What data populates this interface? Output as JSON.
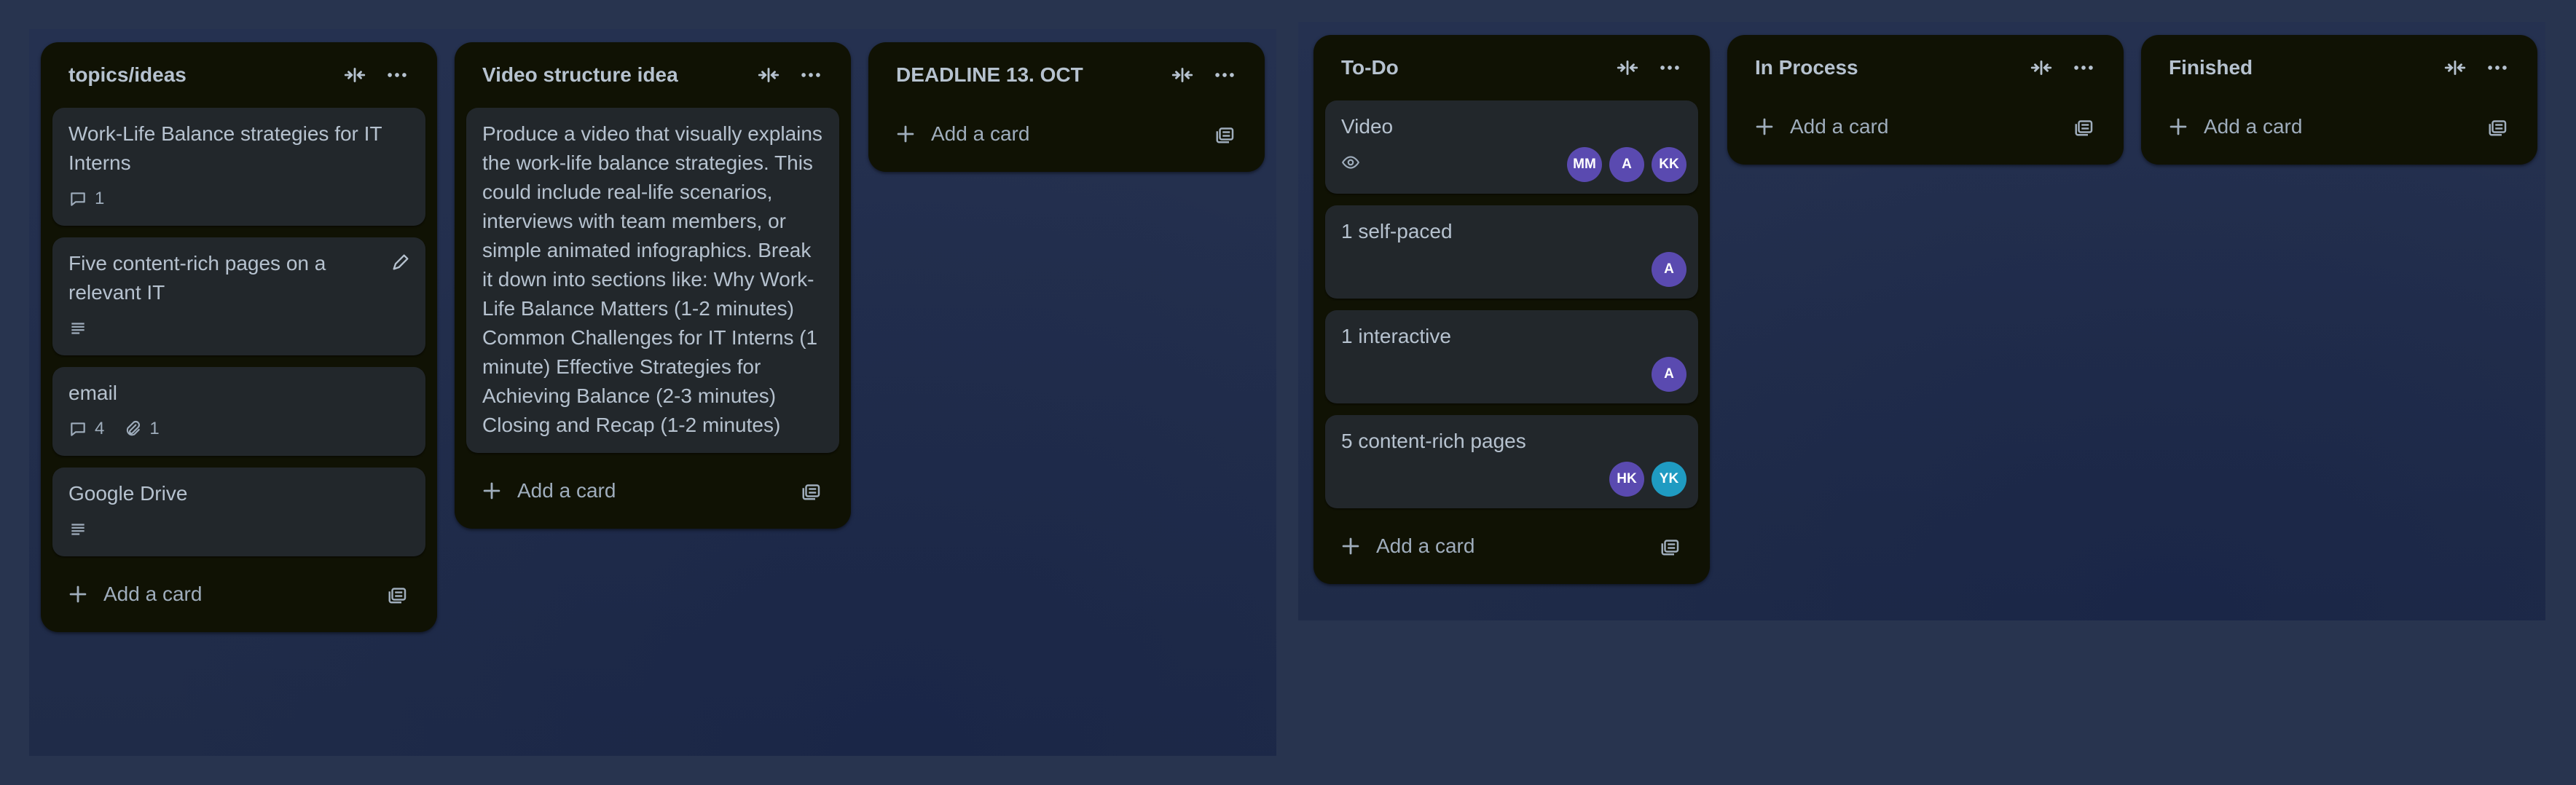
{
  "colors": {
    "page_bg": "#28344f",
    "list_bg": "#101204",
    "card_bg": "#22272b",
    "text": "#b6c2cf",
    "muted_text": "#9fadbc",
    "avatar_purple": "#5a4ab0",
    "avatar_teal": "#1f9bc2"
  },
  "add_card_label": "Add a card",
  "lists": [
    {
      "title": "topics/ideas",
      "cards": [
        {
          "title": "Work-Life Balance strategies for IT Interns",
          "comments": "1"
        },
        {
          "title": "Five content-rich pages on a relevant IT",
          "has_description": true,
          "edit_icon": "pencil-icon"
        },
        {
          "title": "email",
          "comments": "4",
          "attachments": "1"
        },
        {
          "title": "Google Drive",
          "has_description": true
        }
      ]
    },
    {
      "title": "Video structure idea",
      "cards": [
        {
          "title": "Produce a video that visually explains the work-life balance strategies. This could include real-life scenarios, interviews with team members, or simple animated infographics. Break it down into sections like: Why Work-Life Balance Matters (1-2 minutes) Common Challenges for IT Interns (1 minute) Effective Strategies for Achieving Balance (2-3 minutes) Closing and Recap (1-2 minutes)"
        }
      ]
    },
    {
      "title": "DEADLINE 13. OCT",
      "cards": []
    },
    {
      "title": "To-Do",
      "cards": [
        {
          "title": "Video",
          "watching": true,
          "members": [
            "MM",
            "A",
            "KK"
          ]
        },
        {
          "title": "1 self-paced",
          "members": [
            "A"
          ]
        },
        {
          "title": "1 interactive",
          "members": [
            "A"
          ]
        },
        {
          "title": "5 content-rich pages",
          "members": [
            "HK",
            "YK"
          ]
        }
      ]
    },
    {
      "title": "In Process",
      "cards": []
    },
    {
      "title": "Finished",
      "cards": []
    }
  ],
  "icons": {
    "collapse": "collapse-icon",
    "menu": "more-options-icon",
    "plus": "plus-icon",
    "template": "card-template-icon",
    "comment": "comment-icon",
    "attachment": "paperclip-icon",
    "description": "description-icon",
    "watch": "eye-icon"
  }
}
